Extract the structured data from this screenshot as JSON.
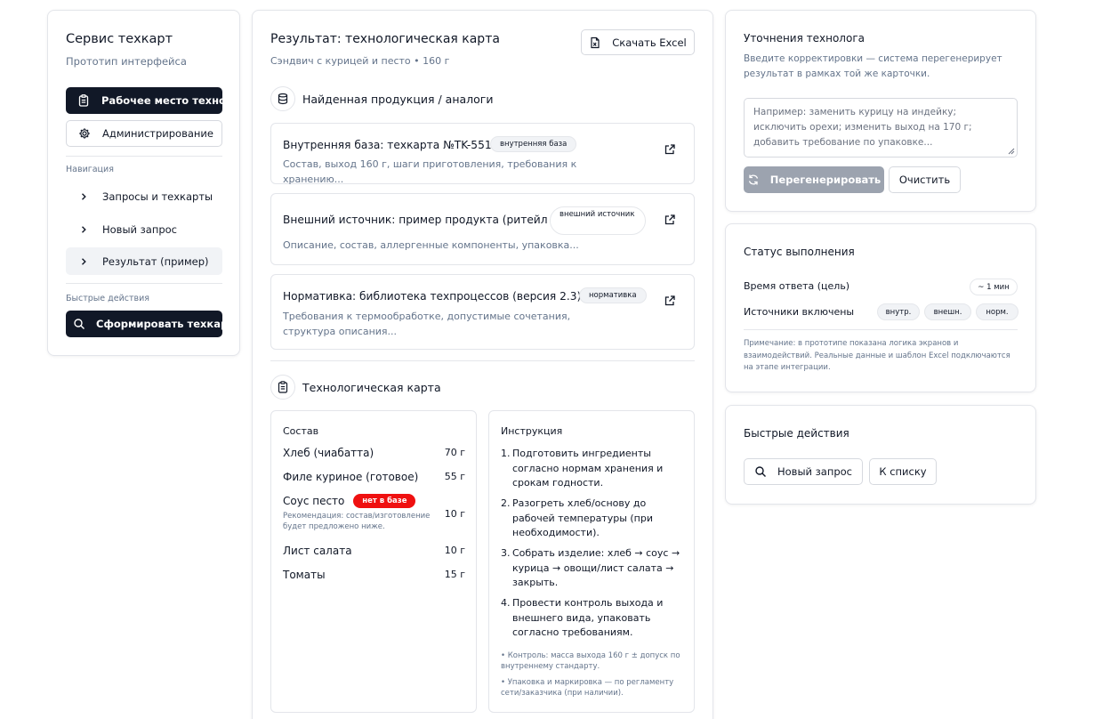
{
  "sidebar": {
    "app_title": "Сервис техкарт",
    "app_subtitle": "Прототип интерфейса",
    "workplace_button": "Рабочее место технолога",
    "admin_button": "Администрирование",
    "nav_label": "Навигация",
    "nav_items": [
      {
        "label": "Запросы и техкарты",
        "active": false
      },
      {
        "label": "Новый запрос",
        "active": false
      },
      {
        "label": "Результат (пример)",
        "active": true
      }
    ],
    "quick_label": "Быстрые действия",
    "generate_button": "Сформировать техкарту"
  },
  "main": {
    "title": "Результат: технологическая карта",
    "subtitle": "Сэндвич с курицей и песто • 160 г",
    "download_button": "Скачать Excel",
    "products_heading": "Найденная продукция / аналоги",
    "results": [
      {
        "title": "Внутренняя база: техкарта №TK-551",
        "badge": "внутренняя база",
        "description": "Состав, выход 160 г, шаги приготовления, требования к хранению..."
      },
      {
        "title": "Внешний источник: пример продукта (ритейл)",
        "badge": "внешний источник",
        "description": "Описание, состав, аллергенные компоненты, упаковка..."
      },
      {
        "title": "Нормативка: библиотека техпроцессов (версия 2.3)",
        "badge": "нормативка",
        "description": "Требования к термообработке, допустимые сочетания, структура описания..."
      }
    ],
    "techcard_heading": "Технологическая карта",
    "composition": {
      "heading": "Состав",
      "items": [
        {
          "name": "Хлеб (чиабатта)",
          "amount": "70 г"
        },
        {
          "name": "Филе куриное (готовое)",
          "amount": "55 г"
        },
        {
          "name": "Соус песто",
          "amount": "10 г",
          "badge": "нет в базе",
          "note": "Рекомендация: состав/изготовление будет предложено ниже."
        },
        {
          "name": "Лист салата",
          "amount": "10 г"
        },
        {
          "name": "Томаты",
          "amount": "15 г"
        }
      ]
    },
    "instructions": {
      "heading": "Инструкция",
      "steps": [
        "Подготовить ингредиенты согласно нормам хранения и срокам годности.",
        "Разогреть хлеб/основу до рабочей температуры (при необходимости).",
        "Собрать изделие: хлеб → соус → курица → овощи/лист салата → закрыть.",
        "Провести контроль выхода и внешнего вида, упаковать согласно требованиям."
      ],
      "notes": [
        "• Контроль: масса выхода 160 г ± допуск по внутреннему стандарту.",
        "• Упаковка и маркировка — по регламенту сети/заказчика (при наличии)."
      ]
    }
  },
  "refine": {
    "title": "Уточнения технолога",
    "description": "Введите корректировки — система перегенерирует результат в рамках той же карточки.",
    "placeholder": "Например: заменить курицу на индейку; исключить орехи; изменить выход на 170 г; добавить требование по упаковке...",
    "regenerate_button": "Перегенерировать",
    "clear_button": "Очистить"
  },
  "status": {
    "title": "Статус выполнения",
    "response_time_label": "Время ответа (цель)",
    "response_time_value": "~ 1 мин",
    "sources_label": "Источники включены",
    "sources": [
      "внутр.",
      "внешн.",
      "норм."
    ],
    "note": "Примечание: в прототипе показана логика экранов и взаимодействий. Реальные данные и шаблон Excel подключаются на этапе интеграции."
  },
  "quick_actions": {
    "title": "Быстрые действия",
    "new_request_button": "Новый запрос",
    "to_list_button": "К списку"
  },
  "colors": {
    "dark": "#111827",
    "muted": "#64748b",
    "border": "#e3e5ea",
    "danger": "#ef1010",
    "disabled": "#9ca3af"
  }
}
